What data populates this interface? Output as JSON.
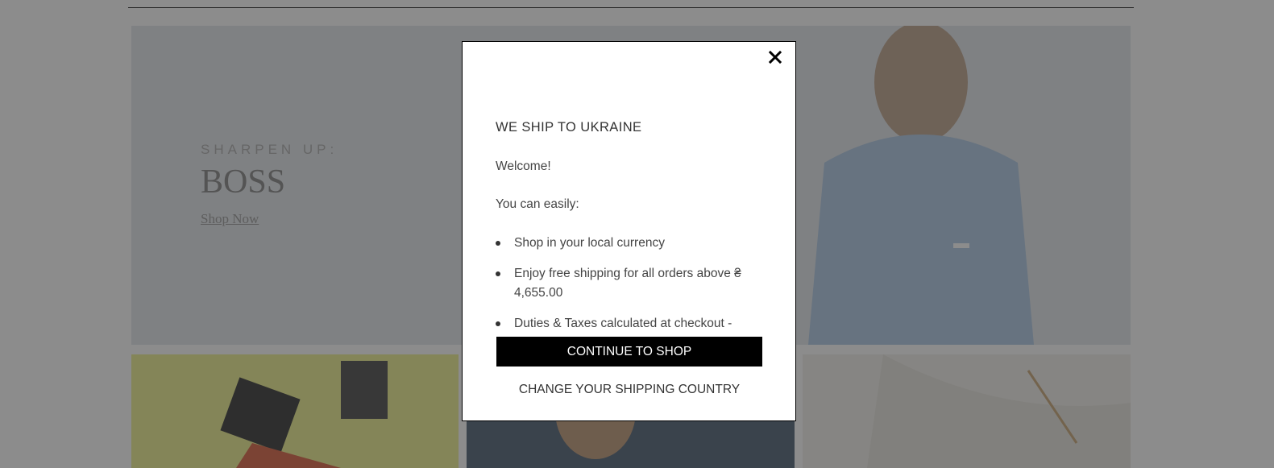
{
  "hero": {
    "kicker": "SHARPEN UP:",
    "title": "BOSS",
    "link": "Shop Now"
  },
  "modal": {
    "title": "WE SHIP TO UKRAINE",
    "welcome": "Welcome!",
    "intro": "You can easily:",
    "bullets": [
      "Shop in your local currency",
      "Enjoy free shipping for all orders above ₴ 4,655.00",
      "Duties & Taxes calculated at checkout - choose to pay now or later"
    ],
    "primary_button": "CONTINUE TO SHOP",
    "secondary_link": "CHANGE YOUR SHIPPING COUNTRY"
  },
  "colors": {
    "overlay": "#000000",
    "button_bg": "#000000",
    "button_text": "#ffffff",
    "hero_bg": "#e8ebef"
  },
  "icons": {
    "close": "close-icon"
  }
}
